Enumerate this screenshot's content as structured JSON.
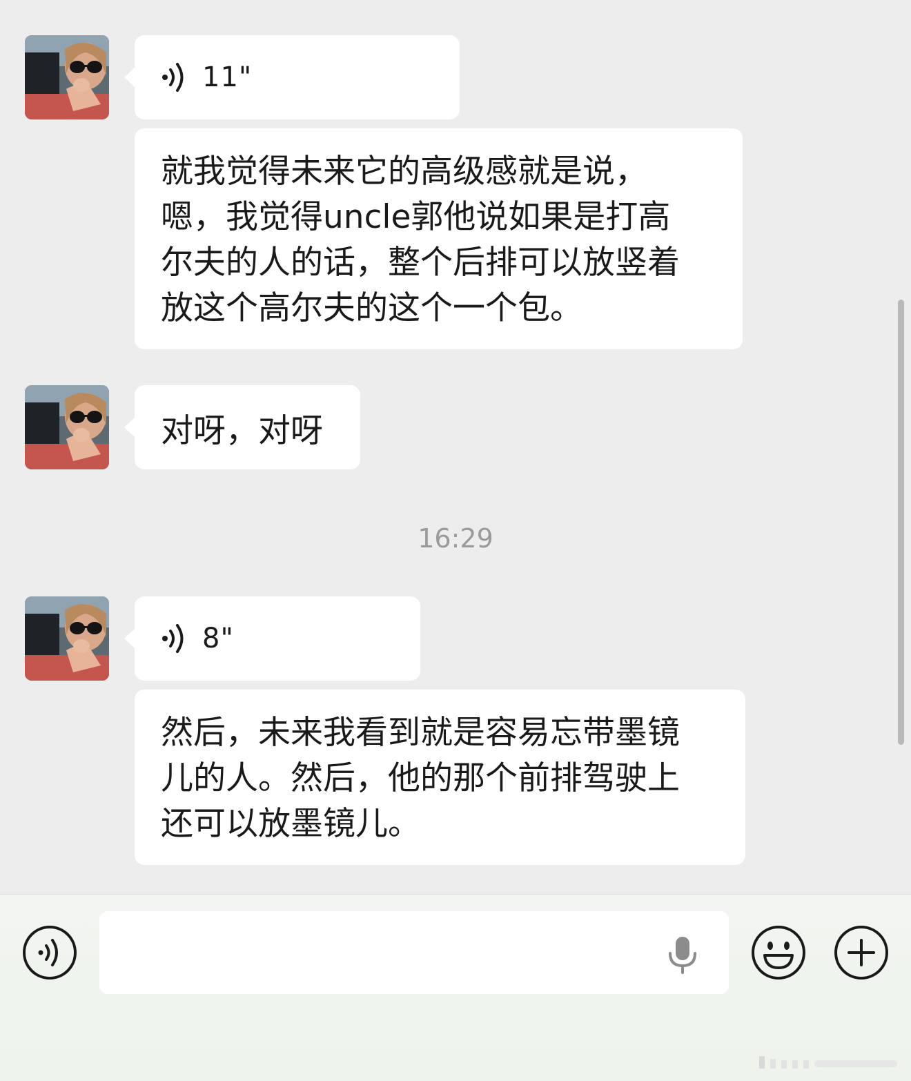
{
  "colors": {
    "background": "#ededed",
    "bubble": "#ffffff",
    "text": "#1a1a1a",
    "timestamp": "#9a9a9a",
    "footer": "#f1f4ef"
  },
  "messages": [
    {
      "type": "voice",
      "duration": "11\"",
      "icon": "voice-wave-icon"
    },
    {
      "type": "text",
      "text": "就我觉得未来它的高级感就是说，\n嗯，我觉得uncle郭他说如果是打高\n尔夫的人的话，整个后排可以放竖着\n放这个高尔夫的这个一个包。"
    },
    {
      "type": "text",
      "text": "对呀，对呀"
    },
    {
      "type": "voice",
      "duration": "8\"",
      "icon": "voice-wave-icon"
    },
    {
      "type": "text",
      "text": "然后，未来我看到就是容易忘带墨镜\n儿的人。然后，他的那个前排驾驶上\n还可以放墨镜儿。"
    }
  ],
  "timestamp": "16:29",
  "toolbar": {
    "voice_toggle_icon": "voice-wave-icon",
    "input_placeholder": "",
    "mic_icon": "microphone-icon",
    "emoji_icon": "smiley-face-icon",
    "more_icon": "plus-icon"
  }
}
